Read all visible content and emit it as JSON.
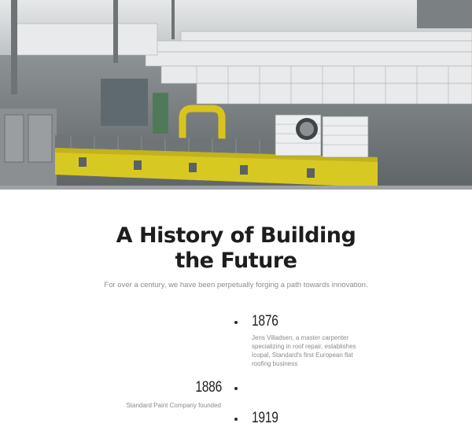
{
  "hero": {
    "image": "warehouse-production-line-photo"
  },
  "heading": {
    "line1": "A History of Building",
    "line2": "the Future"
  },
  "subtitle": "For over a century, we have been perpetually forging a path towards innovation.",
  "timeline": [
    {
      "year": "1876",
      "text": "Jens Villadsen, a master carpenter specializing in roof repair, establishes Icopal, Standard's first European flat roofing business"
    },
    {
      "year": "1886",
      "text": "Standard Paint Company founded"
    },
    {
      "year": "1919",
      "text": ""
    }
  ]
}
